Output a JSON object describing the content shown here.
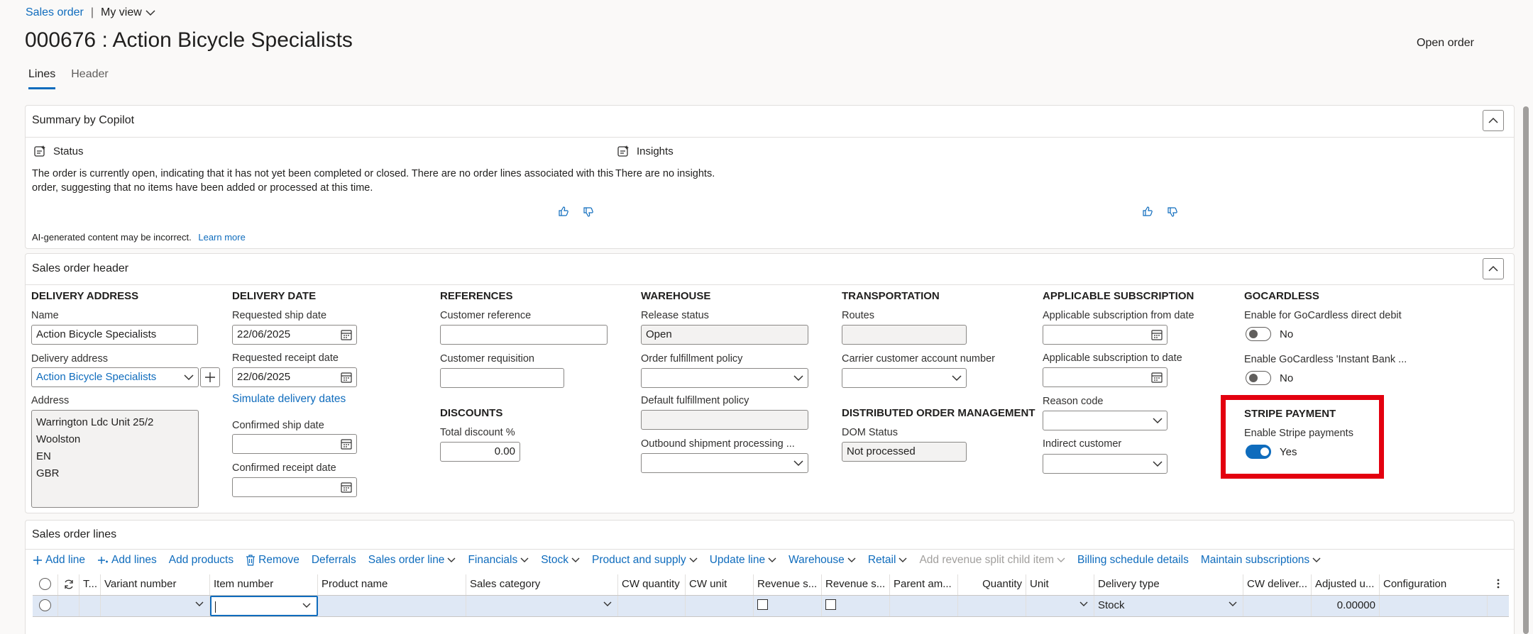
{
  "breadcrumb": {
    "root": "Sales order",
    "separator": "|",
    "view": "My view"
  },
  "page_title": "000676 : Action Bicycle Specialists",
  "actions": {
    "open_order": "Open order"
  },
  "tabs": [
    {
      "label": "Lines",
      "active": true
    },
    {
      "label": "Header",
      "active": false
    }
  ],
  "copilot": {
    "title": "Summary by Copilot",
    "status_heading": "Status",
    "status_text": "The order is currently open, indicating that it has not yet been completed or closed. There are no order lines associated with this order, suggesting that no items have been added or processed at this time.",
    "insights_heading": "Insights",
    "insights_text": "There are no insights.",
    "disclaimer": "AI-generated content may be incorrect.",
    "learn_more": "Learn more"
  },
  "header": {
    "title": "Sales order header",
    "delivery_address": {
      "title": "DELIVERY ADDRESS",
      "name_label": "Name",
      "name_value": "Action Bicycle Specialists",
      "delivery_address_label": "Delivery address",
      "delivery_address_value": "Action Bicycle Specialists",
      "address_label": "Address",
      "address_lines": [
        "Warrington Ldc Unit 25/2",
        "Woolston",
        "EN",
        "GBR"
      ]
    },
    "delivery_date": {
      "title": "DELIVERY DATE",
      "requested_ship_label": "Requested ship date",
      "requested_ship_value": "22/06/2025",
      "requested_receipt_label": "Requested receipt date",
      "requested_receipt_value": "22/06/2025",
      "simulate_link": "Simulate delivery dates",
      "confirmed_ship_label": "Confirmed ship date",
      "confirmed_ship_value": "",
      "confirmed_receipt_label": "Confirmed receipt date",
      "confirmed_receipt_value": ""
    },
    "references": {
      "title": "REFERENCES",
      "customer_reference_label": "Customer reference",
      "customer_reference_value": "",
      "customer_requisition_label": "Customer requisition",
      "customer_requisition_value": ""
    },
    "discounts": {
      "title": "DISCOUNTS",
      "total_discount_label": "Total discount %",
      "total_discount_value": "0.00"
    },
    "warehouse": {
      "title": "WAREHOUSE",
      "release_status_label": "Release status",
      "release_status_value": "Open",
      "order_fulfillment_label": "Order fulfillment policy",
      "order_fulfillment_value": "",
      "default_fulfillment_label": "Default fulfillment policy",
      "default_fulfillment_value": "",
      "outbound_label": "Outbound shipment processing ...",
      "outbound_value": ""
    },
    "transportation": {
      "title": "TRANSPORTATION",
      "routes_label": "Routes",
      "routes_value": "",
      "carrier_label": "Carrier customer account number",
      "carrier_value": ""
    },
    "dom": {
      "title": "DISTRIBUTED ORDER MANAGEMENT",
      "status_label": "DOM Status",
      "status_value": "Not processed"
    },
    "subscription": {
      "title": "APPLICABLE SUBSCRIPTION",
      "from_label": "Applicable subscription from date",
      "from_value": "",
      "to_label": "Applicable subscription to date",
      "to_value": "",
      "reason_label": "Reason code",
      "reason_value": "",
      "indirect_label": "Indirect customer",
      "indirect_value": ""
    },
    "gocardless": {
      "title": "GOCARDLESS",
      "direct_debit_label": "Enable for GoCardless direct debit",
      "direct_debit_value": "No",
      "instant_bank_label": "Enable GoCardless 'Instant Bank ...",
      "instant_bank_value": "No"
    },
    "stripe": {
      "title": "STRIPE PAYMENT",
      "enable_label": "Enable Stripe payments",
      "enable_value": "Yes",
      "highlight_color": "#e3000f"
    }
  },
  "lines": {
    "title": "Sales order lines",
    "toolbar": [
      {
        "label": "Add line",
        "icon": "plus-icon"
      },
      {
        "label": "Add lines",
        "icon": "plus-multiple-icon"
      },
      {
        "label": "Add products"
      },
      {
        "label": "Remove",
        "icon": "trash-icon"
      },
      {
        "label": "Deferrals"
      },
      {
        "label": "Sales order line",
        "dropdown": true
      },
      {
        "label": "Financials",
        "dropdown": true
      },
      {
        "label": "Stock",
        "dropdown": true
      },
      {
        "label": "Product and supply",
        "dropdown": true
      },
      {
        "label": "Update line",
        "dropdown": true
      },
      {
        "label": "Warehouse",
        "dropdown": true
      },
      {
        "label": "Retail",
        "dropdown": true
      },
      {
        "label": "Add revenue split child item",
        "dropdown": true,
        "disabled": true
      },
      {
        "label": "Billing schedule details"
      },
      {
        "label": "Maintain subscriptions",
        "dropdown": true
      }
    ],
    "columns": [
      "T...",
      "Variant number",
      "Item number",
      "Product name",
      "Sales category",
      "CW quantity",
      "CW unit",
      "Revenue s...",
      "Revenue s...",
      "Parent am...",
      "Quantity",
      "Unit",
      "Delivery type",
      "CW deliver...",
      "Adjusted u...",
      "Configuration"
    ],
    "row": {
      "delivery_type": "Stock",
      "adjusted_unit_price": "0.00000"
    }
  },
  "colors": {
    "accent": "#0f6cbd",
    "selected_row": "#dfe8f5"
  }
}
